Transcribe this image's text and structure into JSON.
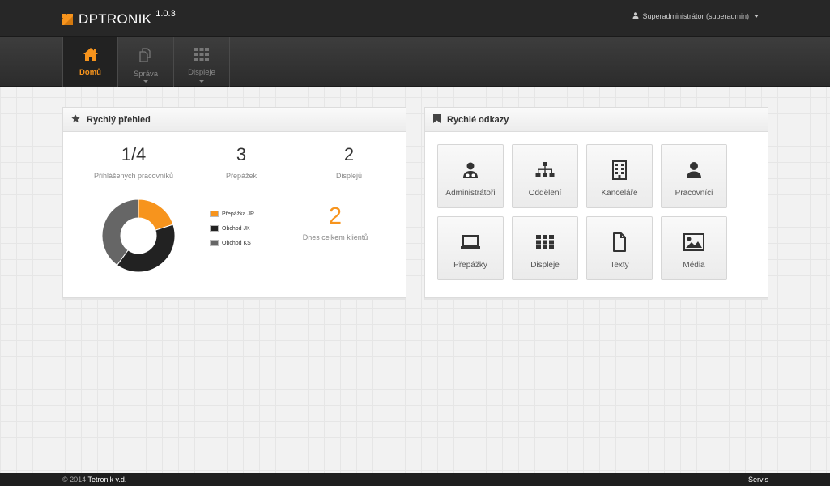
{
  "app": {
    "name": "DPTRONIK",
    "version": "1.0.3",
    "accent_color": "#f7941d"
  },
  "user_menu": {
    "label": "Superadministrátor (superadmin)",
    "icon": "user-icon"
  },
  "nav": {
    "items": [
      {
        "label": "Domů",
        "icon": "home-icon",
        "active": true
      },
      {
        "label": "Správa",
        "icon": "documents-icon",
        "dropdown": true
      },
      {
        "label": "Displeje",
        "icon": "grid-icon",
        "dropdown": true
      }
    ]
  },
  "overview": {
    "title": "Rychlý přehled",
    "icon": "star-icon",
    "stats": [
      {
        "value": "1/4",
        "label": "Přihlášených pracovníků"
      },
      {
        "value": "3",
        "label": "Přepážek"
      },
      {
        "value": "2",
        "label": "Displejů"
      }
    ],
    "today": {
      "value": "2",
      "label": "Dnes celkem klientů"
    }
  },
  "chart_data": {
    "type": "pie",
    "donut": true,
    "categories": [
      "Přepážka JR",
      "Obchod JK",
      "Obchod KS"
    ],
    "values": [
      1,
      2,
      2
    ],
    "colors": [
      "#f7941d",
      "#222222",
      "#666666"
    ],
    "legend": "right"
  },
  "quick_links": {
    "title": "Rychlé odkazy",
    "icon": "bookmark-icon",
    "items": [
      {
        "label": "Administrátoři",
        "icon": "user-md-icon"
      },
      {
        "label": "Oddělení",
        "icon": "sitemap-icon"
      },
      {
        "label": "Kanceláře",
        "icon": "building-icon"
      },
      {
        "label": "Pracovníci",
        "icon": "user-icon"
      },
      {
        "label": "Přepážky",
        "icon": "laptop-icon"
      },
      {
        "label": "Displeje",
        "icon": "grid-icon"
      },
      {
        "label": "Texty",
        "icon": "file-icon"
      },
      {
        "label": "Média",
        "icon": "image-icon"
      }
    ]
  },
  "footer": {
    "copyright": "© 2014",
    "company": "Tetronik v.d.",
    "link": "Servis"
  }
}
